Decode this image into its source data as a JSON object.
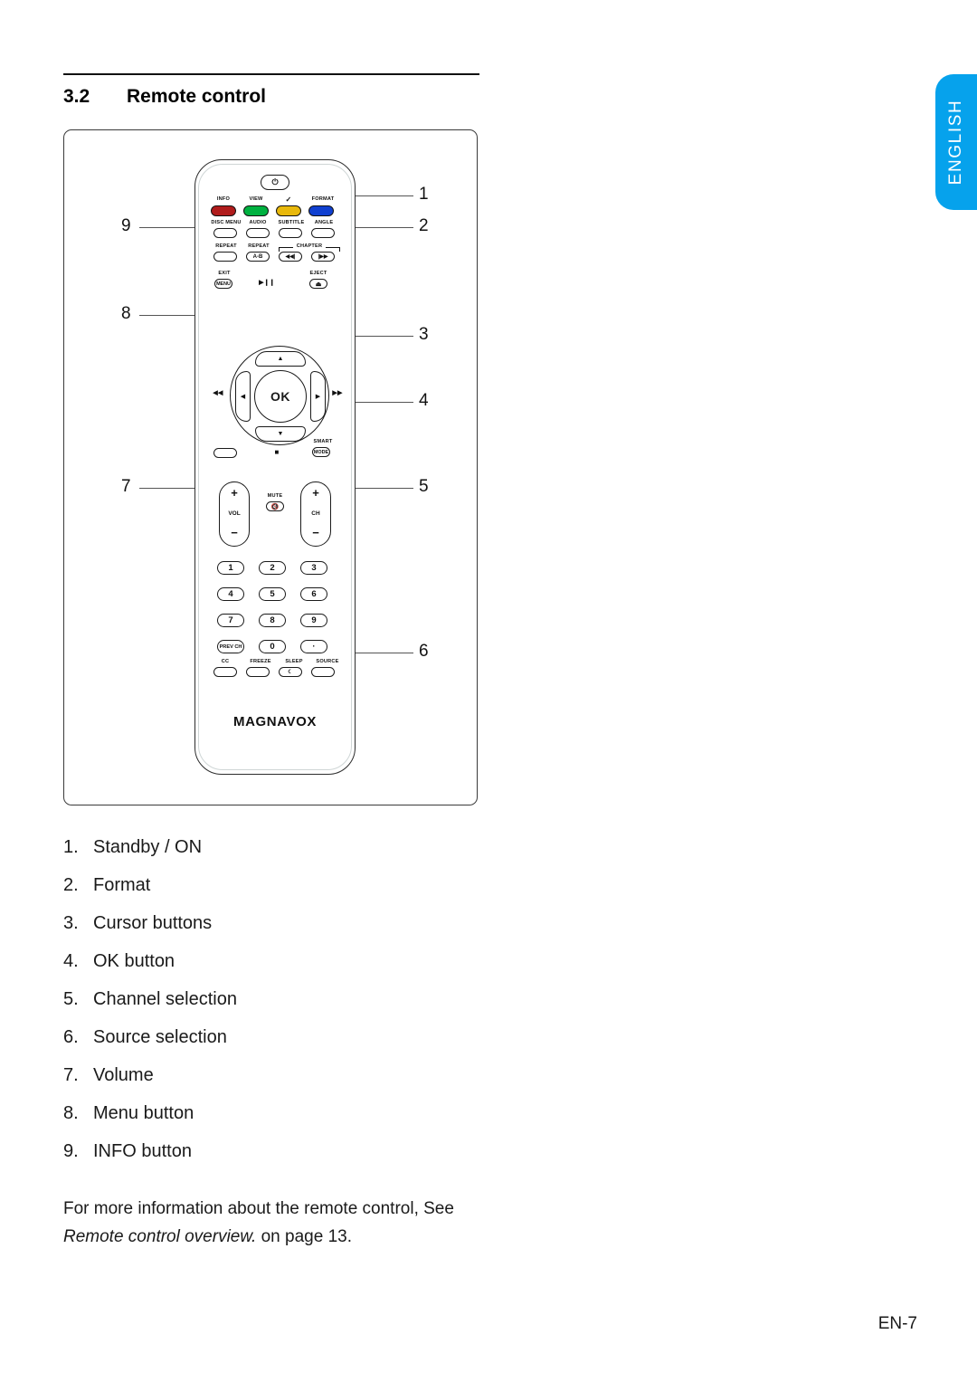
{
  "language_tab": {
    "label": "ENGLISH",
    "color": "#06a2ec"
  },
  "heading": {
    "number": "3.2",
    "title": "Remote control"
  },
  "figure": {
    "brand": "MAGNAVOX",
    "power_icon": "⏻",
    "color_keys": [
      {
        "label": "INFO",
        "color": "#b01c1c",
        "name": "red"
      },
      {
        "label": "VIEW",
        "color": "#00b140",
        "name": "green"
      },
      {
        "label": "✓",
        "color": "#e8b80b",
        "name": "yellow"
      },
      {
        "label": "FORMAT",
        "color": "#1040d0",
        "name": "blue"
      }
    ],
    "row_disc": [
      "DISC MENU",
      "AUDIO",
      "SUBTITLE",
      "ANGLE"
    ],
    "row_repeat": {
      "repeat": "REPEAT",
      "repeat_ab_label": "REPEAT",
      "repeat_ab_key": "A-B",
      "chapter_label": "CHAPTER",
      "chapter_prev": "◀◀|",
      "chapter_next": "|▶▶"
    },
    "row_exit": {
      "exit_label": "EXIT",
      "menu_key": "MENU",
      "playpause": "▶❙❙",
      "eject_label": "EJECT",
      "eject_icon": "⏏"
    },
    "nav": {
      "ok": "OK",
      "up": "▲",
      "down": "▼",
      "left": "◀",
      "right": "▶",
      "rewind": "◀◀",
      "forward": "▶▶",
      "stop": "■",
      "smart_label": "SMART",
      "smart_key": "MODE"
    },
    "volume": {
      "plus": "+",
      "tag": "VOL",
      "minus": "−"
    },
    "channel": {
      "plus": "+",
      "tag": "CH",
      "minus": "−"
    },
    "mute": {
      "label": "MUTE",
      "icon": "🔇"
    },
    "keypad": [
      "1",
      "2",
      "3",
      "4",
      "5",
      "6",
      "7",
      "8",
      "9"
    ],
    "keypad_bottom": {
      "prev_ch": "PREV CH",
      "zero": "0",
      "dot": "·"
    },
    "function_row": [
      {
        "label": "CC",
        "key": ""
      },
      {
        "label": "FREEZE",
        "key": ""
      },
      {
        "label": "SLEEP",
        "key": "☾"
      },
      {
        "label": "SOURCE",
        "key": ""
      }
    ],
    "callouts": [
      {
        "number": "1",
        "side": "right"
      },
      {
        "number": "2",
        "side": "right"
      },
      {
        "number": "3",
        "side": "right"
      },
      {
        "number": "4",
        "side": "right"
      },
      {
        "number": "5",
        "side": "right"
      },
      {
        "number": "6",
        "side": "right"
      },
      {
        "number": "7",
        "side": "left"
      },
      {
        "number": "8",
        "side": "left"
      },
      {
        "number": "9",
        "side": "left"
      }
    ]
  },
  "legend": [
    {
      "index": "1.",
      "text": "Standby / ON"
    },
    {
      "index": "2.",
      "text": "Format"
    },
    {
      "index": "3.",
      "text": "Cursor buttons"
    },
    {
      "index": "4.",
      "text": "OK button"
    },
    {
      "index": "5.",
      "text": "Channel selection"
    },
    {
      "index": "6.",
      "text": "Source selection"
    },
    {
      "index": "7.",
      "text": "Volume"
    },
    {
      "index": "8.",
      "text": "Menu button"
    },
    {
      "index": "9.",
      "text": "INFO button"
    }
  ],
  "note": {
    "line1": "For more information about the remote control, See",
    "italic": "Remote control overview.",
    "line2_tail": " on page 13."
  },
  "page_number": "EN-7"
}
